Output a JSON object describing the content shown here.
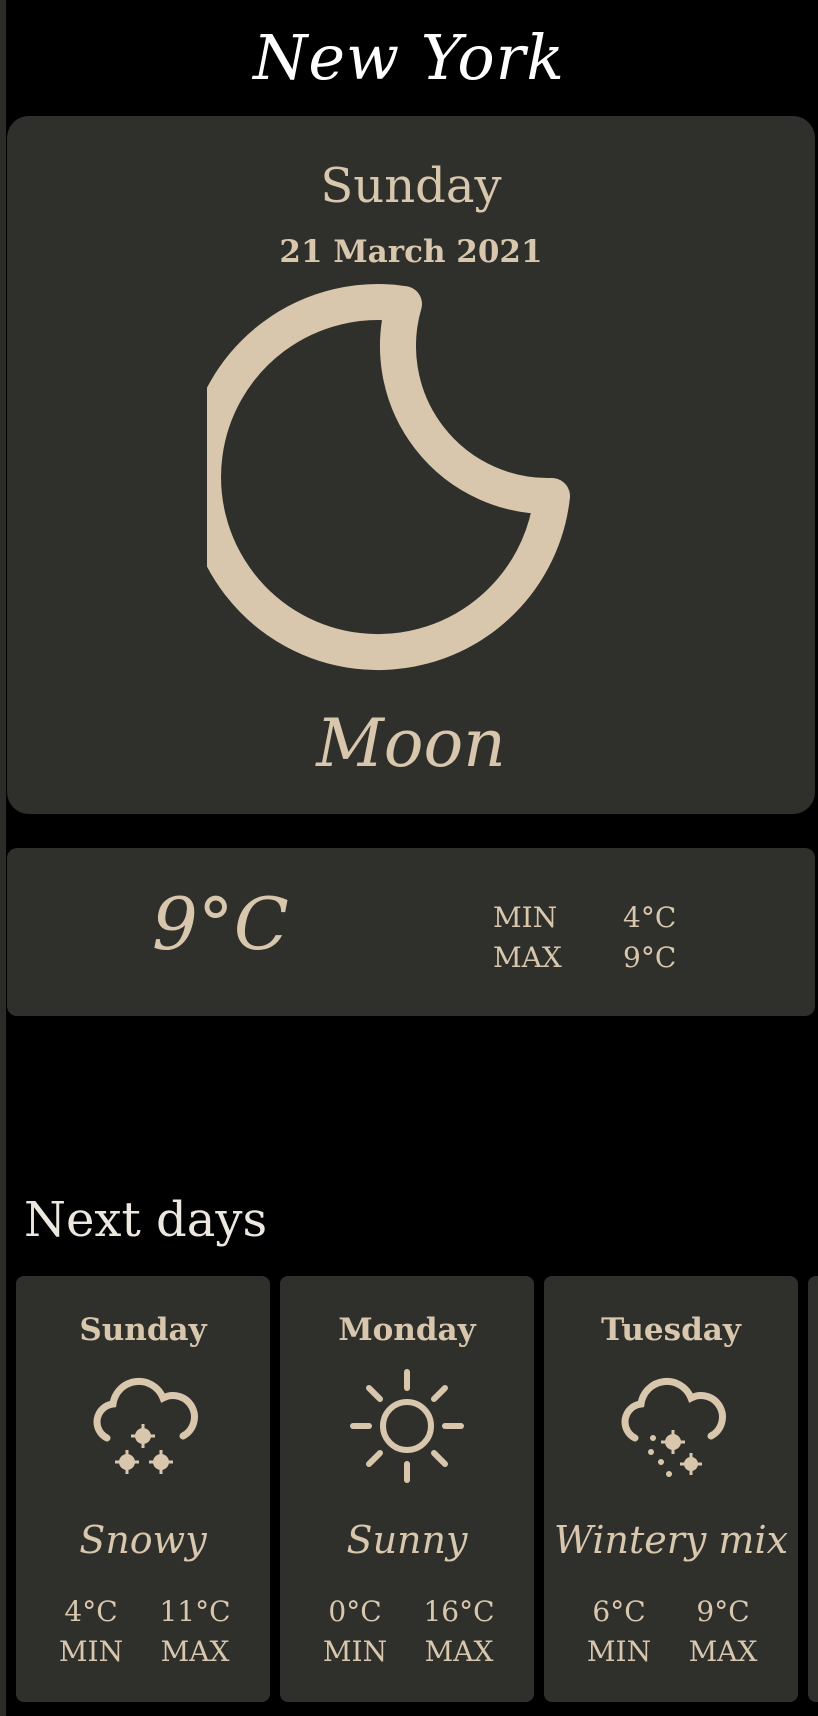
{
  "city": "New York",
  "current": {
    "day": "Sunday",
    "date": "21 March 2021",
    "icon": "moon-icon",
    "condition": "Moon",
    "temperature": "9°C",
    "min_label": "MIN",
    "min_value": "4°C",
    "max_label": "MAX",
    "max_value": "9°C"
  },
  "next_days": {
    "title": "Next days",
    "days": [
      {
        "day": "Sunday",
        "icon": "snow-cloud-icon",
        "condition": "Snowy",
        "min": "4°C",
        "max": "11°C",
        "min_label": "MIN",
        "max_label": "MAX"
      },
      {
        "day": "Monday",
        "icon": "sun-icon",
        "condition": "Sunny",
        "min": "0°C",
        "max": "16°C",
        "min_label": "MIN",
        "max_label": "MAX"
      },
      {
        "day": "Tuesday",
        "icon": "wintery-mix-cloud-icon",
        "condition": "Wintery mix",
        "min": "6°C",
        "max": "9°C",
        "min_label": "MIN",
        "max_label": "MAX"
      }
    ]
  },
  "colors": {
    "background": "#000000",
    "card": "#2f302c",
    "accent": "#d8c7ad",
    "title": "#ffffff"
  }
}
